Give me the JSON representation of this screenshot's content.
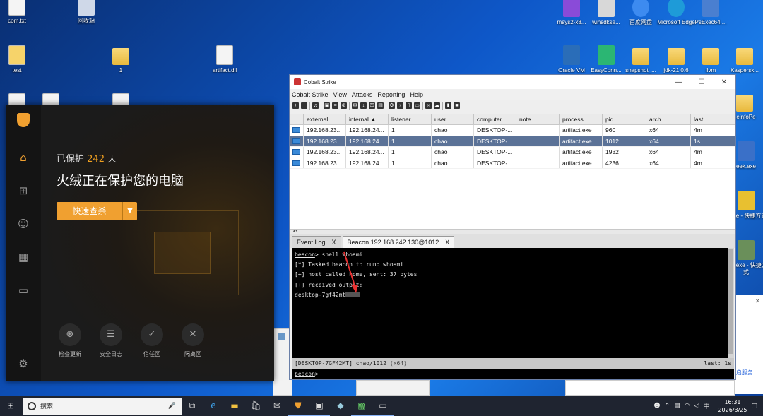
{
  "desktop": {
    "icons": [
      {
        "label": "com.txt",
        "type": "file"
      },
      {
        "label": "回收站",
        "type": "app"
      },
      {
        "label": "test",
        "type": "file"
      },
      {
        "label": "1",
        "type": "folder"
      },
      {
        "label": "artifact.dll",
        "type": "file"
      },
      {
        "label": "msys2-x8...",
        "type": "app"
      },
      {
        "label": "winsdkse...",
        "type": "app"
      },
      {
        "label": "百度网盘",
        "type": "app"
      },
      {
        "label": "Microsoft Edge",
        "type": "app"
      },
      {
        "label": "PsExec64....",
        "type": "app"
      },
      {
        "label": "Oracle VM",
        "type": "app"
      },
      {
        "label": "EasyConn...",
        "type": "app"
      },
      {
        "label": "snapshot_...",
        "type": "folder"
      },
      {
        "label": "jdk-21.0.6",
        "type": "folder"
      },
      {
        "label": "llvm",
        "type": "folder"
      },
      {
        "label": "Kaspersk...",
        "type": "folder"
      },
      {
        "label": "xeinfoPe",
        "type": "folder"
      },
      {
        "label": "eek.exe",
        "type": "app"
      },
      {
        "label": "e.exe - 快捷方式",
        "type": "app"
      },
      {
        "label": "a64.exe - 快捷方式",
        "type": "app"
      }
    ],
    "partial_text": "启服务"
  },
  "huorong": {
    "days_prefix": "已保护",
    "days_value": "242",
    "days_suffix": "天",
    "title": "火绒正在保护您的电脑",
    "scan_button": "快速查杀",
    "tools": [
      "检查更新",
      "安全日志",
      "信任区",
      "隔离区"
    ],
    "accent": "#f0a030"
  },
  "cs": {
    "title": "Cobalt Strike",
    "menu": [
      "Cobalt Strike",
      "View",
      "Attacks",
      "Reporting",
      "Help"
    ],
    "columns": [
      "",
      "external",
      "internal ▲",
      "listener",
      "user",
      "computer",
      "note",
      "process",
      "pid",
      "arch",
      "last"
    ],
    "rows": [
      {
        "external": "192.168.23...",
        "internal": "192.168.24...",
        "listener": "1",
        "user": "chao",
        "computer": "DESKTOP-...",
        "note": "",
        "process": "artifact.exe",
        "pid": "960",
        "arch": "x64",
        "last": "4m",
        "selected": false
      },
      {
        "external": "192.168.23...",
        "internal": "192.168.24...",
        "listener": "1",
        "user": "chao",
        "computer": "DESKTOP-...",
        "note": "",
        "process": "artifact.exe",
        "pid": "1012",
        "arch": "x64",
        "last": "1s",
        "selected": true
      },
      {
        "external": "192.168.23...",
        "internal": "192.168.24...",
        "listener": "1",
        "user": "chao",
        "computer": "DESKTOP-...",
        "note": "",
        "process": "artifact.exe",
        "pid": "1932",
        "arch": "x64",
        "last": "4m",
        "selected": false
      },
      {
        "external": "192.168.23...",
        "internal": "192.168.24...",
        "listener": "1",
        "user": "chao",
        "computer": "DESKTOP-...",
        "note": "",
        "process": "artifact.exe",
        "pid": "4236",
        "arch": "x64",
        "last": "4m",
        "selected": false
      }
    ],
    "tabs": [
      {
        "label": "Event Log",
        "close": "X",
        "active": false
      },
      {
        "label": "Beacon 192.168.242.130@1012",
        "close": "X",
        "active": true
      }
    ],
    "console": {
      "prompt": "beacon",
      "cmd": "> shell whoami",
      "line1": "[*] Tasked beacon to run: whoami",
      "line2": "[+] host called home, sent: 37 bytes",
      "line3": "[+] received output:",
      "line4": "desktop-7gf42mt"
    },
    "status_left": "[DESKTOP-7GF42MT] chao/1012",
    "status_arch": "(x64)",
    "status_right": "last: 1s",
    "input_prompt": "beacon",
    "input_rest": ">"
  },
  "taskbar": {
    "search_placeholder": "搜索",
    "time": "16:31",
    "date": "2026/3/25",
    "ime": "中"
  }
}
